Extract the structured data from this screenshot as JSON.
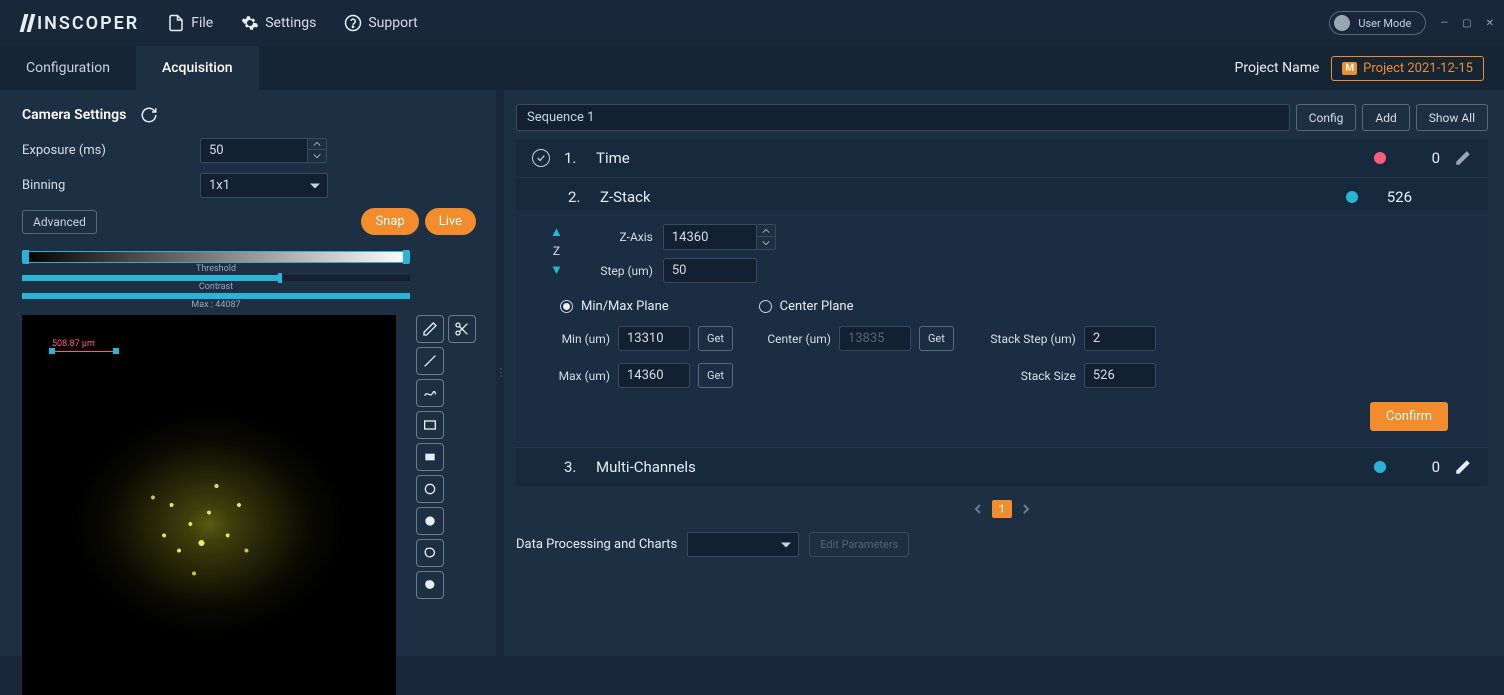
{
  "titlebar": {
    "logo": "INSCOPER",
    "file": "File",
    "settings": "Settings",
    "support": "Support",
    "usermode": "User Mode"
  },
  "tabs": {
    "configuration": "Configuration",
    "acquisition": "Acquisition"
  },
  "project": {
    "label": "Project Name",
    "tag": "M",
    "value": "Project 2021-12-15"
  },
  "camera": {
    "title": "Camera Settings",
    "exposure_label": "Exposure (ms)",
    "exposure_value": "50",
    "binning_label": "Binning",
    "binning_value": "1x1",
    "advanced": "Advanced",
    "snap": "Snap",
    "live": "Live",
    "threshold_label": "Threshold",
    "contrast_label": "Contrast",
    "max_label": "Max : 44087",
    "scale_label": "508.87 µm"
  },
  "sequence": {
    "name": "Sequence 1",
    "config": "Config",
    "add": "Add",
    "showall": "Show All"
  },
  "steps": {
    "s1": {
      "num": "1.",
      "name": "Time",
      "count": "0"
    },
    "s2": {
      "num": "2.",
      "name": "Z-Stack",
      "count": "526",
      "zaxis_label": "Z-Axis",
      "zaxis_value": "14360",
      "step_label": "Step (um)",
      "step_value": "50",
      "z_label": "Z",
      "minmax_label": "Min/Max Plane",
      "center_label": "Center Plane",
      "min_label": "Min (um)",
      "min_value": "13310",
      "max_label": "Max (um)",
      "max_value": "14360",
      "center_um_label": "Center (um)",
      "center_um_value": "13835",
      "stackstep_label": "Stack Step (um)",
      "stackstep_value": "2",
      "stacksize_label": "Stack Size",
      "stacksize_value": "526",
      "get": "Get",
      "confirm": "Confirm"
    },
    "s3": {
      "num": "3.",
      "name": "Multi-Channels",
      "count": "0"
    }
  },
  "pager": {
    "page": "1"
  },
  "dp": {
    "label": "Data Processing and Charts",
    "editparams": "Edit Parameters"
  }
}
